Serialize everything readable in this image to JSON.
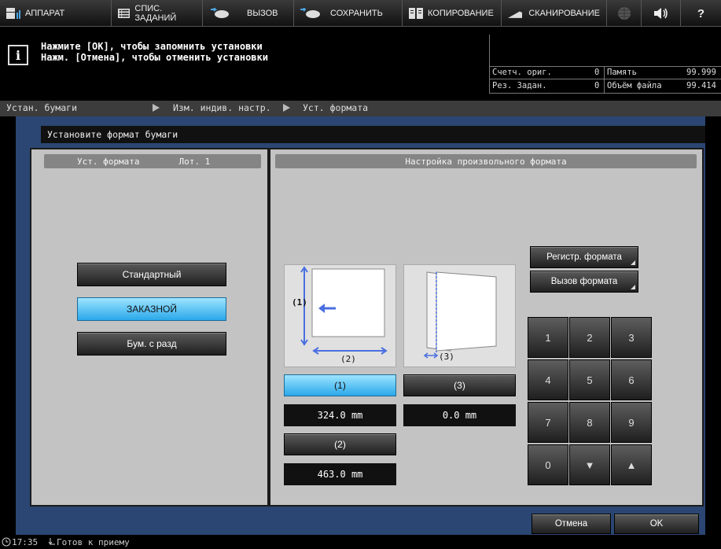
{
  "topbar": {
    "machine": "АППАРАТ",
    "job_list": "СПИС. ЗАДАНИЙ",
    "recall": "ВЫЗОВ",
    "save": "СОХРАНИТЬ",
    "copy": "КОПИРОВАНИЕ",
    "scan": "СКАНИРОВАНИЕ",
    "help": "?"
  },
  "message": {
    "line1": "Нажмите [OK], чтобы запомнить установки",
    "line2": "Нажм. [Отмена], чтобы отменить установки"
  },
  "counters": {
    "orig_label": "Счетч. ориг.",
    "orig_value": "0",
    "mem_label": "Память",
    "mem_value": "99.999",
    "res_label": "Рез. Задан.",
    "res_value": "0",
    "file_label": "Объём файла",
    "file_value": "99.414"
  },
  "breadcrumb": {
    "c1": "Устан. бумаги",
    "c2": "Изм. индив. настр.",
    "c3": "Уст. формата"
  },
  "dialog": {
    "title": "Установите формат бумаги"
  },
  "left_panel": {
    "head_title": "Уст. формата",
    "head_tray": "Лот. 1",
    "btn_standard": "Стандартный",
    "btn_custom": "ЗАКАЗНОЙ",
    "btn_tab": "Бум. с разд"
  },
  "right_panel": {
    "head": "Настройка произвольного формата",
    "diagram_label1": "(1)",
    "diagram_label2": "(2)",
    "diagram_label3": "(3)",
    "btn1": "(1)",
    "val1": "324.0  mm",
    "btn3": "(3)",
    "val3": "0.0  mm",
    "btn2": "(2)",
    "val2": "463.0  mm",
    "register": "Регистр. формата",
    "recall": "Вызов формата",
    "keys": [
      "1",
      "2",
      "3",
      "4",
      "5",
      "6",
      "7",
      "8",
      "9",
      "0",
      "▼",
      "▲"
    ]
  },
  "footer": {
    "cancel": "Отмена",
    "ok": "OK"
  },
  "status": {
    "time": "17:35",
    "text": "Готов к приему"
  },
  "colors": {
    "accent_blue": "#2aa8ea",
    "panel_bg": "#2b4672",
    "diagram_arrow": "#4a6fe0"
  }
}
